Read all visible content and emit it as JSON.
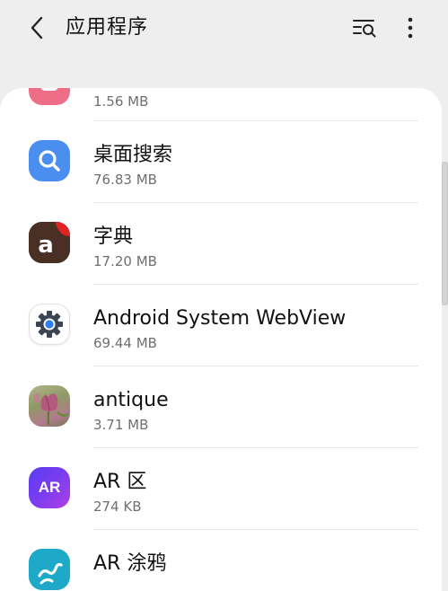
{
  "header": {
    "title": "应用程序"
  },
  "apps": [
    {
      "name": "",
      "size": "1.56 MB",
      "icon": "pink-app-icon"
    },
    {
      "name": "桌面搜索",
      "size": "76.83 MB",
      "icon": "search-icon"
    },
    {
      "name": "字典",
      "size": "17.20 MB",
      "icon": "dictionary-icon",
      "icon_letter": "a"
    },
    {
      "name": "Android System WebView",
      "size": "69.44 MB",
      "icon": "gear-icon"
    },
    {
      "name": "antique",
      "size": "3.71 MB",
      "icon": "tulip-icon"
    },
    {
      "name": "AR 区",
      "size": "274 KB",
      "icon": "ar-icon",
      "icon_text": "AR"
    },
    {
      "name": "AR 涂鸦",
      "size": "",
      "icon": "doodle-icon"
    }
  ],
  "colors": {
    "background": "#eeeeee",
    "card": "#ffffff",
    "search_blue": "#4a8ff0",
    "dictionary_red": "#e02424",
    "ar_purple": "#7a3df0",
    "doodle_teal": "#1fa9c8",
    "pink": "#ee6d87"
  }
}
